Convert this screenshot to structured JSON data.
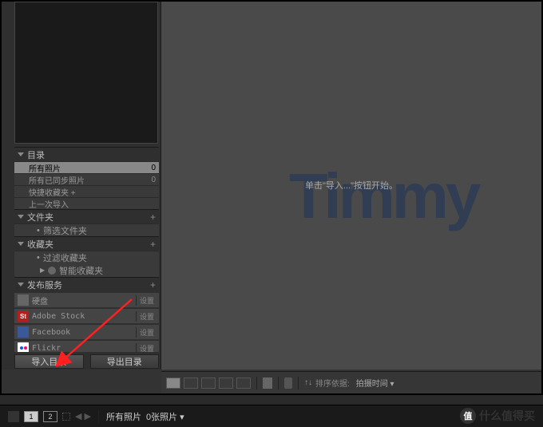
{
  "sidebar": {
    "sections": {
      "catalog": {
        "title": "目录",
        "items": [
          {
            "label": "所有照片",
            "count": "0",
            "selected": true
          },
          {
            "label": "所有已同步照片",
            "count": "0"
          },
          {
            "label": "快捷收藏夹 +",
            "count": ""
          },
          {
            "label": "上一次导入",
            "count": ""
          }
        ]
      },
      "folders": {
        "title": "文件夹",
        "filter": "筛选文件夹"
      },
      "collections": {
        "title": "收藏夹",
        "filter": "过滤收藏夹",
        "smart": "智能收藏夹"
      },
      "publish": {
        "title": "发布服务",
        "services": [
          {
            "label": "硬盘",
            "action": "设置"
          },
          {
            "label": "Adobe Stock",
            "action": "设置"
          },
          {
            "label": "Facebook",
            "action": "设置"
          },
          {
            "label": "Flickr",
            "action": "设置"
          }
        ]
      }
    },
    "buttons": {
      "import": "导入目录",
      "export": "导出目录"
    }
  },
  "main": {
    "hint": "单击\"导入...\"按钮开始。"
  },
  "toolbar": {
    "sort_label": "排序依据:",
    "sort_value": "拍摄时间 ▾"
  },
  "filmstrip": {
    "n1": "1",
    "n2": "2",
    "label": "所有照片",
    "count": "0张照片 ▾"
  },
  "watermark": "Timmy",
  "footer": {
    "badge": "值",
    "text": "什么值得买"
  }
}
